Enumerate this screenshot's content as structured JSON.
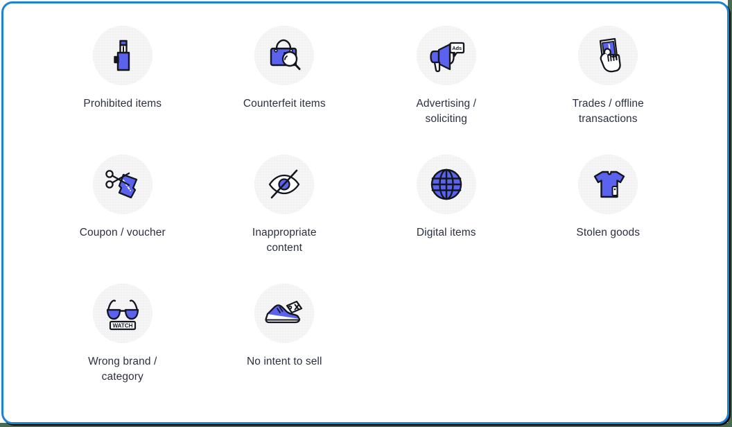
{
  "theme": {
    "page_background": "#4a6b4f",
    "card_background": "#ffffff",
    "card_border": "#1b82d8",
    "icon_accent": "#5a62ee",
    "icon_outline": "#14161d",
    "icon_circle_background": "#f5f5f6",
    "label_color": "#2b3040"
  },
  "panel": {
    "title": "",
    "columns": 4
  },
  "tiles": [
    {
      "id": "prohibited-items",
      "label": "Prohibited items",
      "icon": "vape-device-icon",
      "row": 1,
      "column": 1
    },
    {
      "id": "counterfeit-items",
      "label": "Counterfeit items",
      "icon": "handbag-magnifier-icon",
      "row": 1,
      "column": 2
    },
    {
      "id": "advertising-soliciting",
      "label": "Advertising / soliciting",
      "icon": "megaphone-ads-icon",
      "icon_text": "Ads",
      "row": 1,
      "column": 3
    },
    {
      "id": "trades-offline-transactions",
      "label": "Trades / offline transactions",
      "icon": "hand-cash-icon",
      "row": 1,
      "column": 4
    },
    {
      "id": "coupon-voucher",
      "label": "Coupon / voucher",
      "icon": "scissors-coupon-icon",
      "row": 2,
      "column": 1
    },
    {
      "id": "inappropriate-content",
      "label": "Inappropriate content",
      "icon": "eye-slash-icon",
      "row": 2,
      "column": 2
    },
    {
      "id": "digital-items",
      "label": "Digital items",
      "icon": "globe-icon",
      "row": 2,
      "column": 3
    },
    {
      "id": "stolen-goods",
      "label": "Stolen goods",
      "icon": "tshirt-tag-icon",
      "row": 2,
      "column": 4
    },
    {
      "id": "wrong-brand-category",
      "label": "Wrong brand / category",
      "icon": "sunglasses-watch-icon",
      "icon_text": "WATCH",
      "row": 3,
      "column": 1
    },
    {
      "id": "no-intent-to-sell",
      "label": "No intent to sell",
      "icon": "sneaker-tag-x-icon",
      "row": 3,
      "column": 2
    }
  ]
}
